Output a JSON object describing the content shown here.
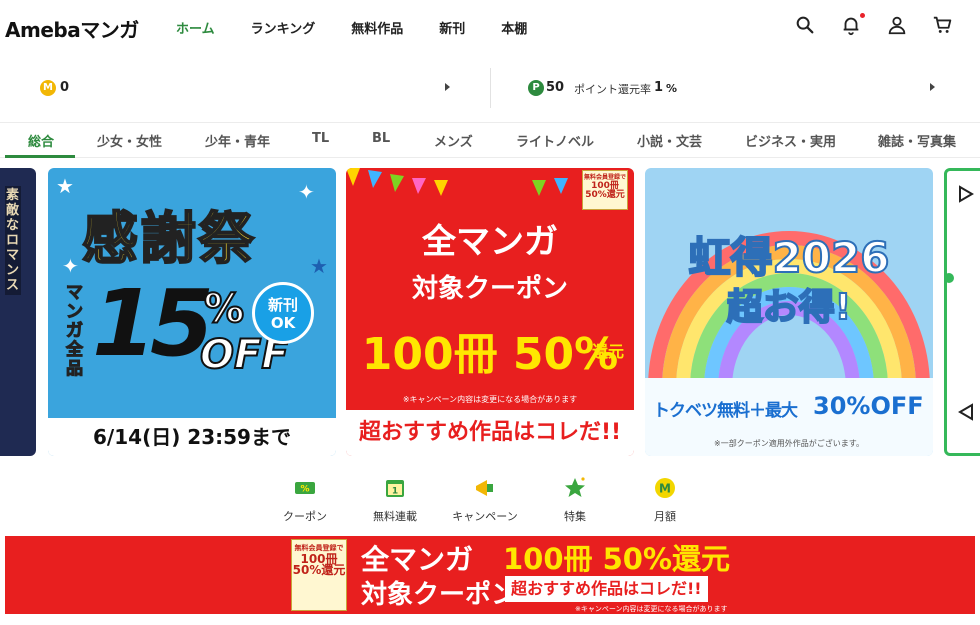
{
  "header": {
    "logo": "Amebaマンガ",
    "nav": [
      "ホーム",
      "ランキング",
      "無料作品",
      "新刊",
      "本棚"
    ],
    "active_nav": 0,
    "icons": [
      "search-icon",
      "bell-icon",
      "user-icon",
      "cart-icon"
    ]
  },
  "points": {
    "coin_symbol": "M",
    "coin_value": "0",
    "point_symbol": "P",
    "point_value": "50",
    "rate_label": "ポイント還元率",
    "rate_value": "1",
    "rate_unit": "%"
  },
  "categories": [
    "総合",
    "少女・女性",
    "少年・青年",
    "TL",
    "BL",
    "メンズ",
    "ライトノベル",
    "小説・文芸",
    "ビジネス・実用",
    "雑誌・写真集"
  ],
  "active_category": 0,
  "carousel": {
    "left_card": {
      "text": "素敵なロマンス"
    },
    "kansha": {
      "title": "感謝祭",
      "side": "マンガ全品",
      "number": "15",
      "pct": "%",
      "off": "OFF",
      "badge_line1": "新刊",
      "badge_line2": "OK",
      "date": "6/14(日) 23:59まで"
    },
    "coupon": {
      "stamp_line1": "無料会員登録で",
      "stamp_line2": "100冊",
      "stamp_line3": "50%還元",
      "title1": "全マンガ",
      "title2": "対象クーポン",
      "big": "100冊 50%",
      "kangen": "還元",
      "note": "※キャンペーン内容は変更になる場合があります",
      "footer": "超おすすめ作品はコレだ!!"
    },
    "niji": {
      "title1": "虹得2026",
      "title2": "超お得!",
      "muryou": "トクベツ無料＋最大",
      "off": "30%OFF",
      "note": "※一部クーポン適用外作品がございます。"
    }
  },
  "quick_links": [
    {
      "label": "クーポン",
      "icon": "coupon-icon"
    },
    {
      "label": "無料連載",
      "icon": "calendar-icon"
    },
    {
      "label": "キャンペーン",
      "icon": "megaphone-icon"
    },
    {
      "label": "特集",
      "icon": "star-icon"
    },
    {
      "label": "月額",
      "icon": "monthly-m-icon"
    }
  ],
  "banner": {
    "stamp_line1": "無料会員登録で",
    "stamp_line2": "100冊",
    "stamp_line3": "50%還元",
    "title1": "全マンガ",
    "title2": "対象クーポン",
    "big": "100冊 50%還元",
    "sub": "超おすすめ作品はコレだ!!",
    "note": "※キャンペーン内容は変更になる場合があります"
  },
  "colors": {
    "accent": "#2d8a3e",
    "coupon_red": "#e81f1f",
    "coin_gold": "#f2b705",
    "kansha_blue": "#3aa4dd"
  }
}
